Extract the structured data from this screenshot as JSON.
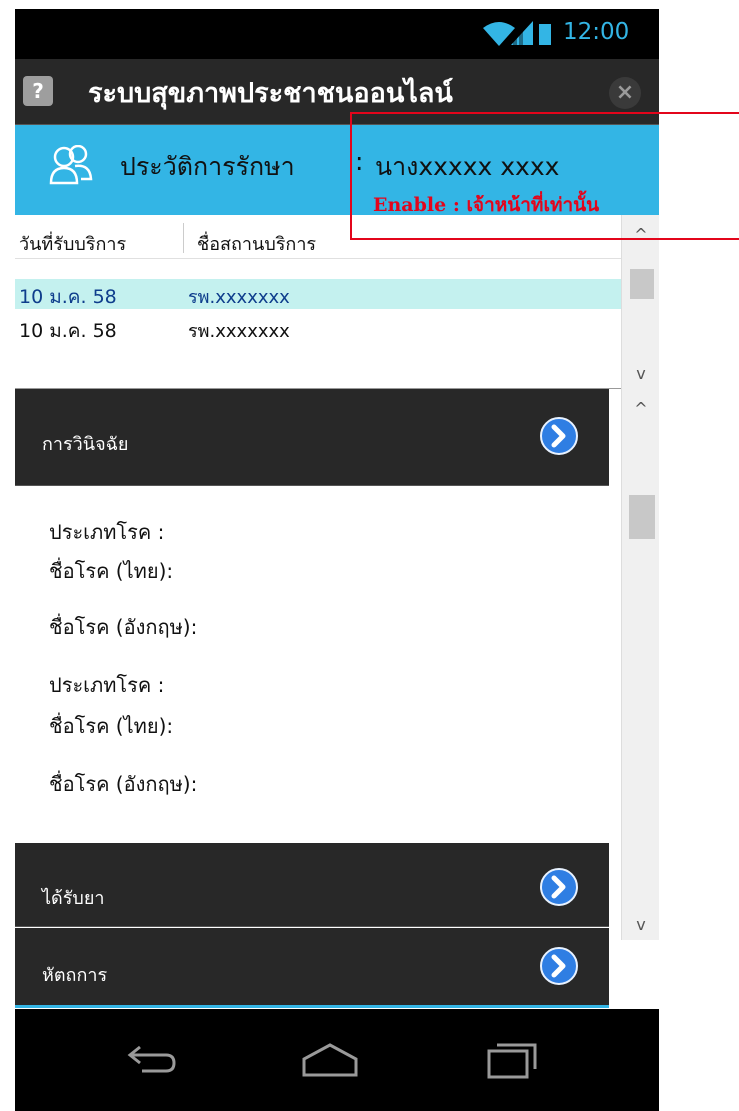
{
  "statusbar": {
    "time": "12:00",
    "accent": "#33b5e5"
  },
  "titlebar": {
    "title": "ระบบสุขภาพประชาชนออนไลน์",
    "help_icon": "?",
    "close_icon": "×"
  },
  "header": {
    "label": "ประวัติการรักษา",
    "separator": ":",
    "patient": "นางxxxxx  xxxx"
  },
  "table": {
    "columns": [
      "วันที่รับบริการ",
      "ชื่อสถานบริการ"
    ],
    "rows": [
      {
        "date": "10 ม.ค. 58",
        "place": "รพ.xxxxxxx",
        "selected": true
      },
      {
        "date": "10 ม.ค. 58",
        "place": "รพ.xxxxxxx",
        "selected": false
      }
    ]
  },
  "annotation": {
    "text": "Enable : เจ้าหน้าที่เท่านั้น",
    "color": "#e3051b"
  },
  "diagnosis": {
    "title": "การวินิจฉัย",
    "fields": [
      "ประเภทโรค :",
      "ชื่อโรค (ไทย):",
      "ชื่อโรค (อังกฤษ):",
      "ประเภทโรค :",
      "ชื่อโรค (ไทย):",
      "ชื่อโรค (อังกฤษ):"
    ]
  },
  "sections": [
    {
      "title": "ได้รับยา"
    },
    {
      "title": "หัตถการ"
    }
  ],
  "scroll": {
    "up": "^",
    "down": "v"
  }
}
